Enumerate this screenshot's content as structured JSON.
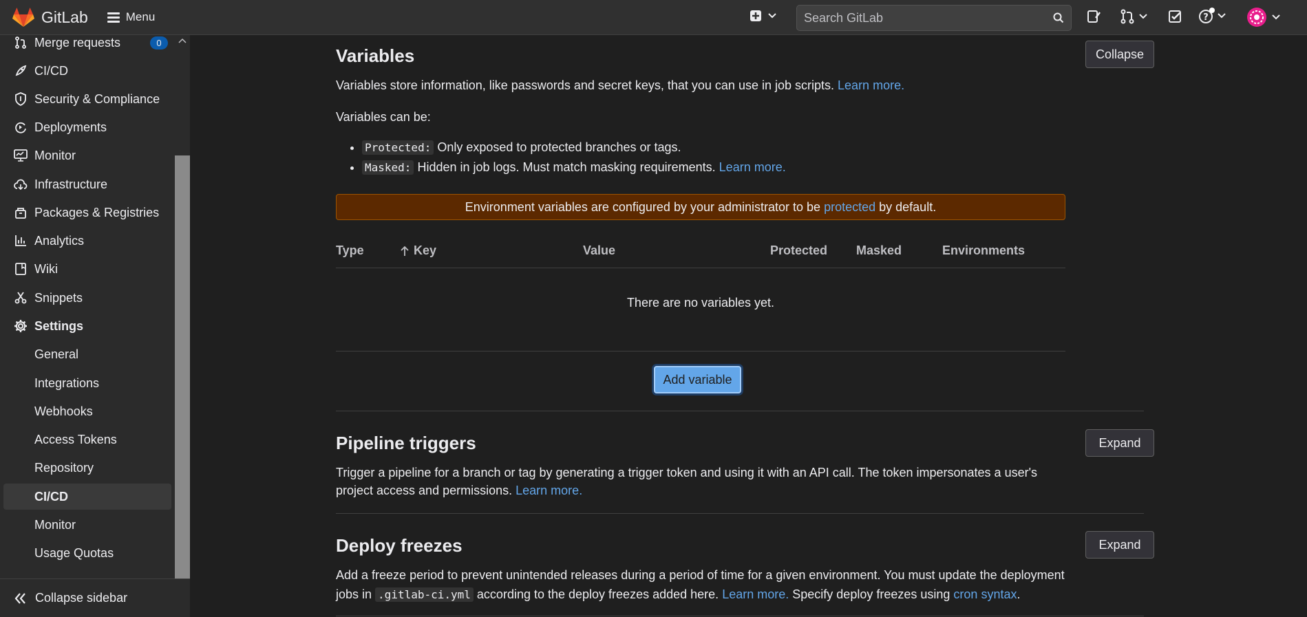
{
  "header": {
    "brand": "GitLab",
    "menu_label": "Menu",
    "search_placeholder": "Search GitLab"
  },
  "sidebar": {
    "items": [
      {
        "label": "Merge requests",
        "icon": "merge-request-icon",
        "badge": "0"
      },
      {
        "label": "CI/CD",
        "icon": "rocket-icon"
      },
      {
        "label": "Security & Compliance",
        "icon": "shield-icon"
      },
      {
        "label": "Deployments",
        "icon": "deployments-icon"
      },
      {
        "label": "Monitor",
        "icon": "monitor-icon"
      },
      {
        "label": "Infrastructure",
        "icon": "cloud-icon"
      },
      {
        "label": "Packages & Registries",
        "icon": "package-icon"
      },
      {
        "label": "Analytics",
        "icon": "chart-icon"
      },
      {
        "label": "Wiki",
        "icon": "book-icon"
      },
      {
        "label": "Snippets",
        "icon": "scissors-icon"
      },
      {
        "label": "Settings",
        "icon": "gear-icon"
      }
    ],
    "settings_sub": [
      "General",
      "Integrations",
      "Webhooks",
      "Access Tokens",
      "Repository",
      "CI/CD",
      "Monitor",
      "Usage Quotas"
    ],
    "active_sub": "CI/CD",
    "collapse_label": "Collapse sidebar"
  },
  "variables": {
    "title": "Variables",
    "collapse_label": "Collapse",
    "desc": "Variables store information, like passwords and secret keys, that you can use in job scripts.",
    "learn_more": "Learn more.",
    "can_be": "Variables can be:",
    "bullet1_code": "Protected:",
    "bullet1_text": "Only exposed to protected branches or tags.",
    "bullet2_code": "Masked:",
    "bullet2_text": "Hidden in job logs. Must match masking requirements.",
    "bullet2_link": "Learn more.",
    "alert_pre": "Environment variables are configured by your administrator to be",
    "alert_link": "protected",
    "alert_post": "by default.",
    "columns": [
      "Type",
      "Key",
      "Value",
      "Protected",
      "Masked",
      "Environments"
    ],
    "empty_text": "There are no variables yet.",
    "add_label": "Add variable"
  },
  "triggers": {
    "title": "Pipeline triggers",
    "expand_label": "Expand",
    "desc": "Trigger a pipeline for a branch or tag by generating a trigger token and using it with an API call. The token impersonates a user's project access and permissions.",
    "learn_more": "Learn more."
  },
  "freezes": {
    "title": "Deploy freezes",
    "expand_label": "Expand",
    "desc_pre": "Add a freeze period to prevent unintended releases during a period of time for a given environment. You must update the deployment jobs in",
    "code": ".gitlab-ci.yml",
    "desc_mid": "according to the deploy freezes added here.",
    "learn_more": "Learn more.",
    "desc_post_pre": "Specify deploy freezes using",
    "cron_link": "cron syntax",
    "desc_end": "."
  }
}
